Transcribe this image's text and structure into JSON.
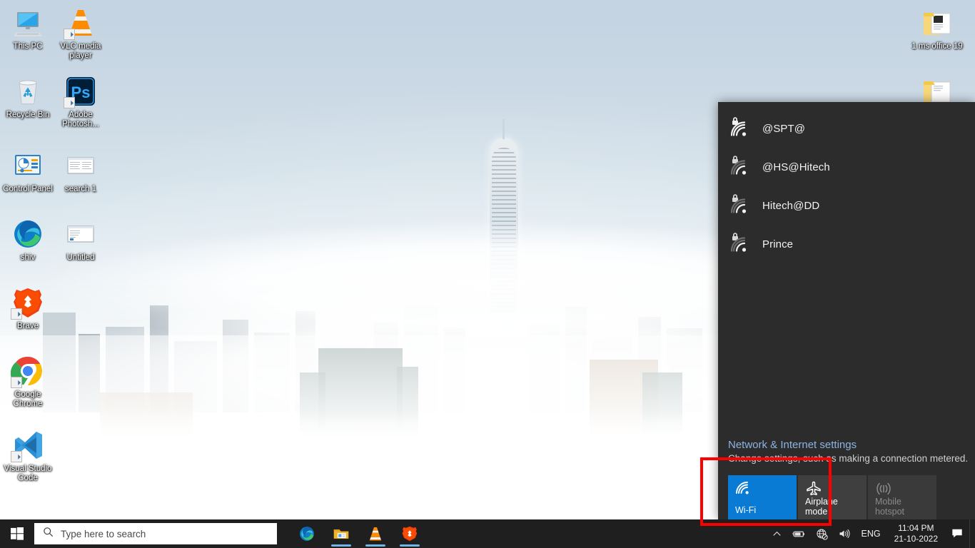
{
  "desktop": {
    "wallpaper_description": "Foggy city skyline with skyscrapers above clouds",
    "icons_left": [
      {
        "label": "This PC",
        "icon": "this-pc-icon",
        "shortcut": false
      },
      {
        "label": "VLC media player",
        "icon": "vlc-cone-icon",
        "shortcut": true
      },
      {
        "label": "Recycle Bin",
        "icon": "recycle-bin-icon",
        "shortcut": false
      },
      {
        "label": "Adobe Photosh...",
        "icon": "adobe-photoshop-icon",
        "shortcut": true
      },
      {
        "label": "Control Panel",
        "icon": "control-panel-icon",
        "shortcut": false
      },
      {
        "label": "search 1",
        "icon": "document-icon",
        "shortcut": false
      },
      {
        "label": "shiv",
        "icon": "microsoft-edge-icon",
        "shortcut": false
      },
      {
        "label": "Untitled",
        "icon": "document-icon",
        "shortcut": false
      },
      {
        "label": "Brave",
        "icon": "brave-lion-icon",
        "shortcut": true
      },
      {
        "label": "Google Chrome",
        "icon": "google-chrome-icon",
        "shortcut": true
      },
      {
        "label": "Visual Studio Code",
        "icon": "visual-studio-code-icon",
        "shortcut": true
      }
    ],
    "icons_right": [
      {
        "label": "1 ms office 19",
        "icon": "folder-icon",
        "shortcut": false
      },
      {
        "label": "",
        "icon": "folder-icon",
        "shortcut": false
      }
    ]
  },
  "flyout": {
    "networks": [
      {
        "ssid": "@SPT@",
        "secured": true,
        "signal": 4
      },
      {
        "ssid": "@HS@Hitech",
        "secured": true,
        "signal": 2
      },
      {
        "ssid": "Hitech@DD",
        "secured": true,
        "signal": 2
      },
      {
        "ssid": "Prince",
        "secured": true,
        "signal": 2
      }
    ],
    "settings_link": "Network & Internet settings",
    "settings_sub": "Change settings, such as making a connection metered.",
    "tiles": [
      {
        "label": "Wi-Fi",
        "icon": "wifi-icon",
        "state": "on"
      },
      {
        "label": "Airplane mode",
        "icon": "airplane-icon",
        "state": "off"
      },
      {
        "label": "Mobile hotspot",
        "icon": "hotspot-icon",
        "state": "disabled"
      }
    ],
    "accent_color": "#0a7bd4",
    "background_color": "#2c2c2c",
    "link_color": "#8cb4e2",
    "highlight_color": "#ff0000"
  },
  "taskbar": {
    "start_label": "Start",
    "search_placeholder": "Type here to search",
    "apps": [
      {
        "name": "Microsoft Edge",
        "icon": "microsoft-edge-icon",
        "running": false
      },
      {
        "name": "File Explorer",
        "icon": "file-explorer-icon",
        "running": true
      },
      {
        "name": "VLC media player",
        "icon": "vlc-cone-icon",
        "running": true
      },
      {
        "name": "Brave",
        "icon": "brave-lion-icon",
        "running": true
      }
    ],
    "tray": [
      {
        "name": "show-hidden-icons",
        "icon": "chevron-up-icon"
      },
      {
        "name": "battery",
        "icon": "battery-charging-icon"
      },
      {
        "name": "network",
        "icon": "globe-no-internet-icon"
      },
      {
        "name": "volume",
        "icon": "speaker-icon"
      }
    ],
    "language": "ENG",
    "time": "11:04 PM",
    "date": "21-10-2022",
    "action_center": "notifications-icon"
  }
}
